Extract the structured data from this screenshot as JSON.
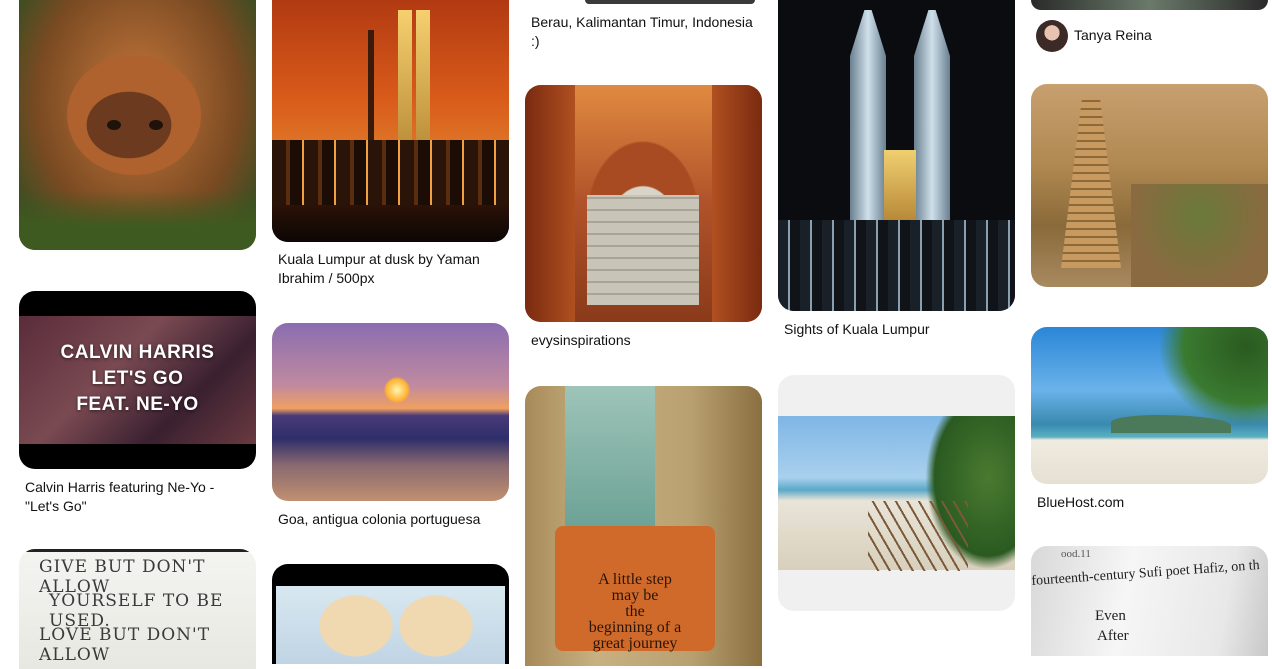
{
  "pins": {
    "orangutan": {
      "caption": ""
    },
    "kl_dusk": {
      "caption": "Kuala Lumpur at dusk by Yaman Ibrahim / 500px"
    },
    "berau": {
      "caption": "Berau, Kalimantan Timur, Indonesia :)"
    },
    "towers": {
      "caption": "Sights of Kuala Lumpur"
    },
    "tanya": {
      "author": "Tanya Reina"
    },
    "temple": {
      "caption": ""
    },
    "calvin": {
      "caption": "Calvin Harris featuring Ne-Yo - \"Let's Go\"",
      "overlay_line1": "CALVIN HARRIS",
      "overlay_line2": "LET'S GO",
      "overlay_line3": "FEAT. NE-YO"
    },
    "goa": {
      "caption": "Goa, antigua colonia portuguesa"
    },
    "evys": {
      "caption": "evysinspirations"
    },
    "beach_boardwalk": {
      "caption": ""
    },
    "bluehost": {
      "caption": "BlueHost.com"
    },
    "quote": {
      "line1": "GIVE BUT DON'T ALLOW",
      "line2": "YOURSELF TO BE USED.",
      "line3": "LOVE BUT DON'T ALLOW"
    },
    "journey": {
      "line1": "A little step",
      "line2": "may be",
      "line3": "the",
      "line4": "beginning of a",
      "line5": "great journey"
    },
    "book": {
      "line0": "ood.11",
      "line1": "fourteenth-century Sufi poet Hafiz, on th",
      "line2": "Even",
      "line3": "After"
    }
  }
}
